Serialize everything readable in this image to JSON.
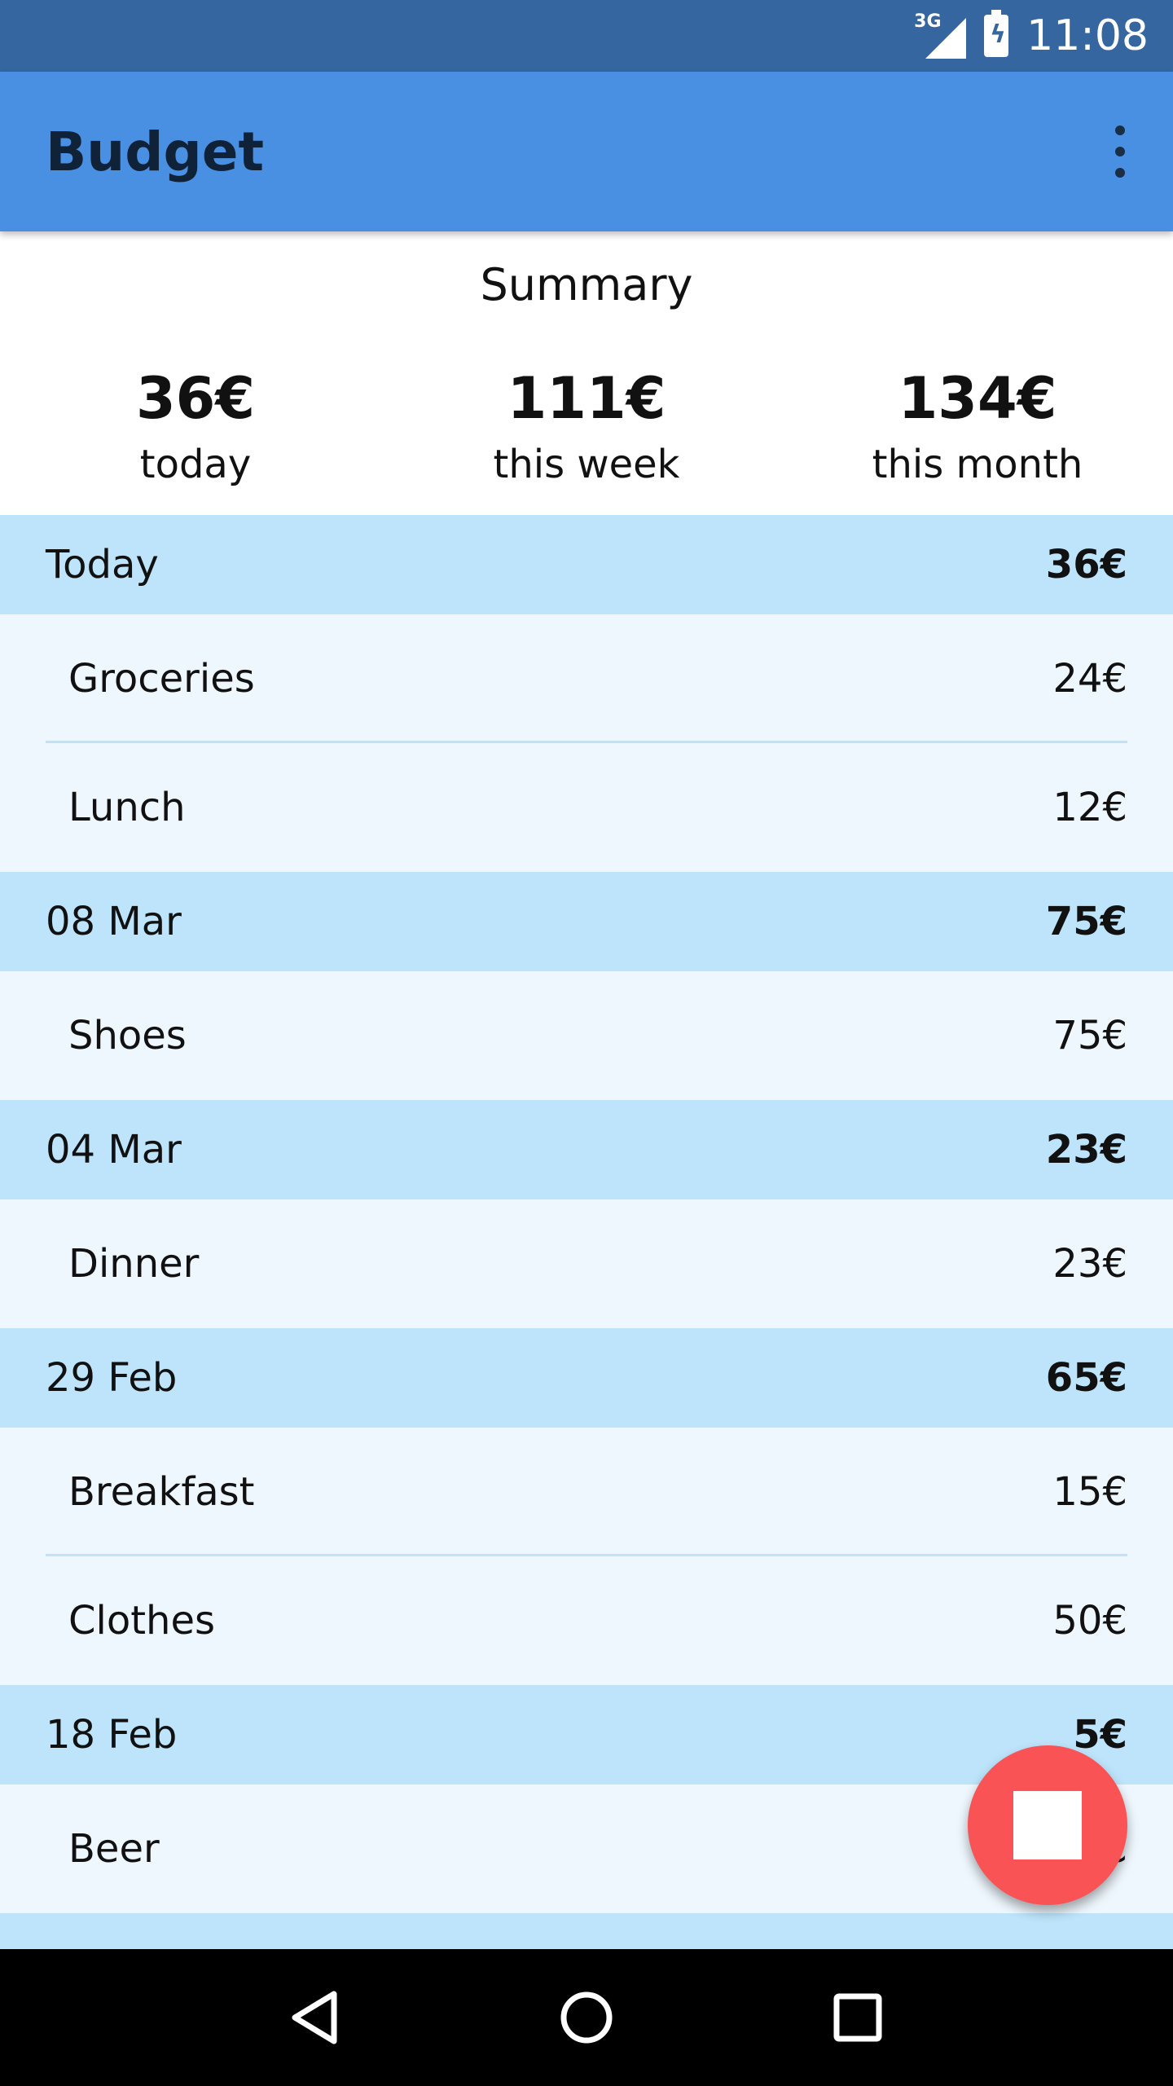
{
  "status_bar": {
    "network": "3G",
    "time": "11:08"
  },
  "app_bar": {
    "title": "Budget",
    "menu_icon": "more-vert-icon"
  },
  "summary": {
    "heading": "Summary",
    "columns": [
      {
        "amount": "36€",
        "label": "today"
      },
      {
        "amount": "111€",
        "label": "this week"
      },
      {
        "amount": "134€",
        "label": "this month"
      }
    ]
  },
  "groups": [
    {
      "date": "Today",
      "total": "36€",
      "entries": [
        {
          "name": "Groceries",
          "amount": "24€"
        },
        {
          "name": "Lunch",
          "amount": "12€"
        }
      ]
    },
    {
      "date": "08 Mar",
      "total": "75€",
      "entries": [
        {
          "name": "Shoes",
          "amount": "75€"
        }
      ]
    },
    {
      "date": "04 Mar",
      "total": "23€",
      "entries": [
        {
          "name": "Dinner",
          "amount": "23€"
        }
      ]
    },
    {
      "date": "29 Feb",
      "total": "65€",
      "entries": [
        {
          "name": "Breakfast",
          "amount": "15€"
        },
        {
          "name": "Clothes",
          "amount": "50€"
        }
      ]
    },
    {
      "date": "18 Feb",
      "total": "5€",
      "entries": [
        {
          "name": "Beer",
          "amount": "5€"
        }
      ]
    }
  ],
  "fab": {
    "icon": "stop-icon",
    "color": "#fa5356"
  },
  "nav_bar": {
    "icons": [
      "back-icon",
      "home-icon",
      "recents-icon"
    ]
  },
  "colors": {
    "status_bar": "#3566a0",
    "app_bar": "#4a90e2",
    "group_header": "#bde4fb",
    "entry_bg": "#eef7fe"
  }
}
